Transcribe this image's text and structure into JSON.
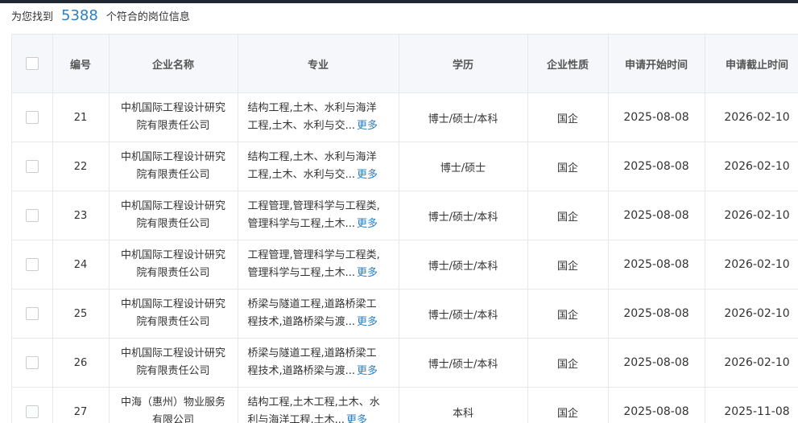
{
  "summary": {
    "prefix": "为您找到",
    "count": "5388",
    "suffix": "个符合的岗位信息"
  },
  "table": {
    "headers": [
      "编号",
      "企业名称",
      "专业",
      "学历",
      "企业性质",
      "申请开始时间",
      "申请截止时间"
    ],
    "more_label": "更多",
    "rows": [
      {
        "id": "21",
        "company_line1": "中机国际工程设计研究",
        "company_line2": "院有限责任公司",
        "major_line1": "结构工程,土木、水利与海洋",
        "major_line2": "工程,土木、水利与交...",
        "education": "博士/硕士/本科",
        "nature": "国企",
        "start": "2025-08-08",
        "end": "2026-02-10"
      },
      {
        "id": "22",
        "company_line1": "中机国际工程设计研究",
        "company_line2": "院有限责任公司",
        "major_line1": "结构工程,土木、水利与海洋",
        "major_line2": "工程,土木、水利与交...",
        "education": "博士/硕士",
        "nature": "国企",
        "start": "2025-08-08",
        "end": "2026-02-10"
      },
      {
        "id": "23",
        "company_line1": "中机国际工程设计研究",
        "company_line2": "院有限责任公司",
        "major_line1": "工程管理,管理科学与工程类,",
        "major_line2": "管理科学与工程,土木...",
        "education": "博士/硕士/本科",
        "nature": "国企",
        "start": "2025-08-08",
        "end": "2026-02-10"
      },
      {
        "id": "24",
        "company_line1": "中机国际工程设计研究",
        "company_line2": "院有限责任公司",
        "major_line1": "工程管理,管理科学与工程类,",
        "major_line2": "管理科学与工程,土木...",
        "education": "博士/硕士/本科",
        "nature": "国企",
        "start": "2025-08-08",
        "end": "2026-02-10"
      },
      {
        "id": "25",
        "company_line1": "中机国际工程设计研究",
        "company_line2": "院有限责任公司",
        "major_line1": "桥梁与隧道工程,道路桥梁工",
        "major_line2": "程技术,道路桥梁与渡...",
        "education": "博士/硕士/本科",
        "nature": "国企",
        "start": "2025-08-08",
        "end": "2026-02-10"
      },
      {
        "id": "26",
        "company_line1": "中机国际工程设计研究",
        "company_line2": "院有限责任公司",
        "major_line1": "桥梁与隧道工程,道路桥梁工",
        "major_line2": "程技术,道路桥梁与渡...",
        "education": "博士/硕士/本科",
        "nature": "国企",
        "start": "2025-08-08",
        "end": "2026-02-10"
      },
      {
        "id": "27",
        "company_line1": "中海（惠州）物业服务",
        "company_line2": "有限公司",
        "major_line1": "结构工程,土木工程,土木、水",
        "major_line2": "利与海洋工程,土木...",
        "education": "本科",
        "nature": "国企",
        "start": "2025-08-08",
        "end": "2025-11-08"
      }
    ]
  },
  "colors": {
    "accent": "#2b7fc3",
    "header_bg": "#f5f7fa",
    "border": "#e6e8eb"
  }
}
